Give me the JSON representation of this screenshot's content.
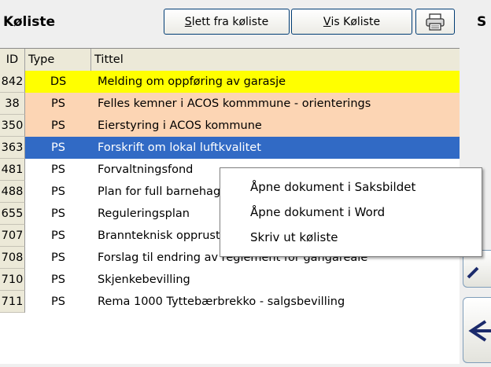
{
  "header": {
    "title": "Køliste",
    "side_letter": "S"
  },
  "toolbar": {
    "slett": {
      "mnemonic": "S",
      "rest": "lett fra køliste"
    },
    "vis": {
      "mnemonic": "V",
      "rest": "is Køliste"
    },
    "print_icon": "printer-icon"
  },
  "columns": {
    "id": "ID",
    "type": "Type",
    "title": "Tittel"
  },
  "rows": [
    {
      "id": "842",
      "type": "DS",
      "title": "Melding om oppføring av garasje",
      "bg": "#ffff00",
      "fg": "#000000"
    },
    {
      "id": "38",
      "type": "PS",
      "title": "Felles kemner i ACOS kommmune - orienterings",
      "bg": "#fcd5b4",
      "fg": "#000000"
    },
    {
      "id": "350",
      "type": "PS",
      "title": "Eierstyring i ACOS kommune",
      "bg": "#fcd5b4",
      "fg": "#000000"
    },
    {
      "id": "363",
      "type": "PS",
      "title": "Forskrift om lokal luftkvalitet",
      "bg": "#316ac5",
      "fg": "#ffffff"
    },
    {
      "id": "481",
      "type": "PS",
      "title": "Forvaltningsfond",
      "bg": "#ffffff",
      "fg": "#000000"
    },
    {
      "id": "488",
      "type": "PS",
      "title": "Plan for full barnehagedekning",
      "bg": "#ffffff",
      "fg": "#000000"
    },
    {
      "id": "655",
      "type": "PS",
      "title": "Reguleringsplan",
      "bg": "#ffffff",
      "fg": "#000000"
    },
    {
      "id": "707",
      "type": "PS",
      "title": "Brannteknisk opprustning av kommunens bygn",
      "bg": "#ffffff",
      "fg": "#000000"
    },
    {
      "id": "708",
      "type": "PS",
      "title": "Forslag til endring av reglement for gangareale",
      "bg": "#ffffff",
      "fg": "#000000"
    },
    {
      "id": "710",
      "type": "PS",
      "title": "Skjenkebevilling",
      "bg": "#ffffff",
      "fg": "#000000"
    },
    {
      "id": "711",
      "type": "PS",
      "title": "Rema 1000  Tyttebærbrekko - salgsbevilling",
      "bg": "#ffffff",
      "fg": "#000000"
    }
  ],
  "context_menu": {
    "items": [
      "Åpne dokument i Saksbildet",
      "Åpne dokument i Word",
      "Skriv ut køliste"
    ]
  }
}
